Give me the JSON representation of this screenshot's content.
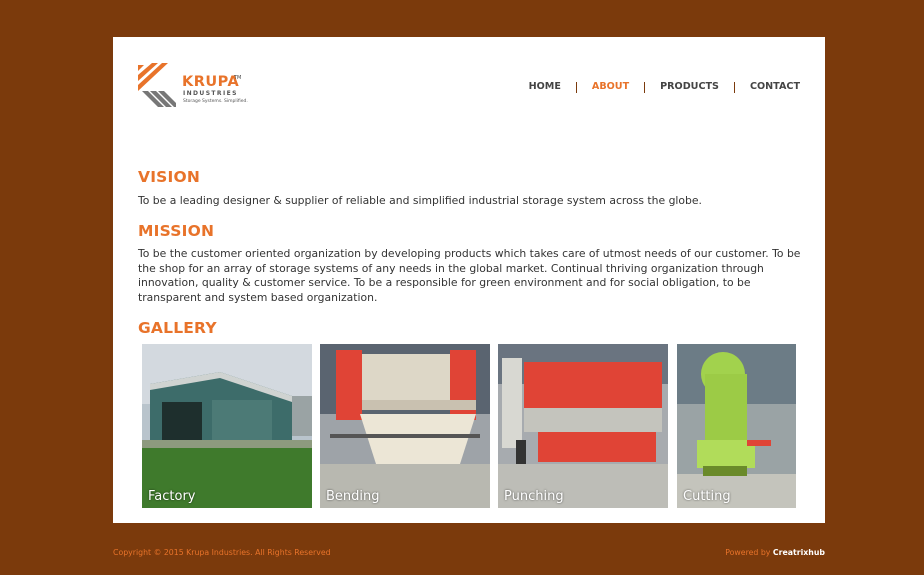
{
  "brand": {
    "name": "KRUPA",
    "tm": "TM",
    "sub": "INDUSTRIES",
    "tagline": "Storage Systems. Simplified.",
    "accent": "#e8732a",
    "background": "#7b3a0c"
  },
  "nav": {
    "home": "HOME",
    "about": "ABOUT",
    "products": "PRODUCTS",
    "contact": "CONTACT",
    "active": "ABOUT"
  },
  "vision": {
    "title": "VISION",
    "text": "To be a leading designer & supplier of reliable and simplified industrial storage system across the globe."
  },
  "mission": {
    "title": "MISSION",
    "text": "To be the customer oriented organization by developing products which takes care of utmost needs of our customer. To be the shop for an array of storage systems of any needs in the global market. Continual thriving organization through innovation, quality & customer service. To be a responsible for green environment and for social obligation, to be transparent and system based organization."
  },
  "gallery": {
    "title": "GALLERY",
    "items": [
      {
        "label": "Factory"
      },
      {
        "label": "Bending"
      },
      {
        "label": "Punching"
      },
      {
        "label": "Cutting"
      }
    ]
  },
  "footer": {
    "copyright": "Copyright © 2015 Krupa Industries. All Rights Reserved",
    "powered_by": "Powered by",
    "company": "Creatrixhub"
  }
}
